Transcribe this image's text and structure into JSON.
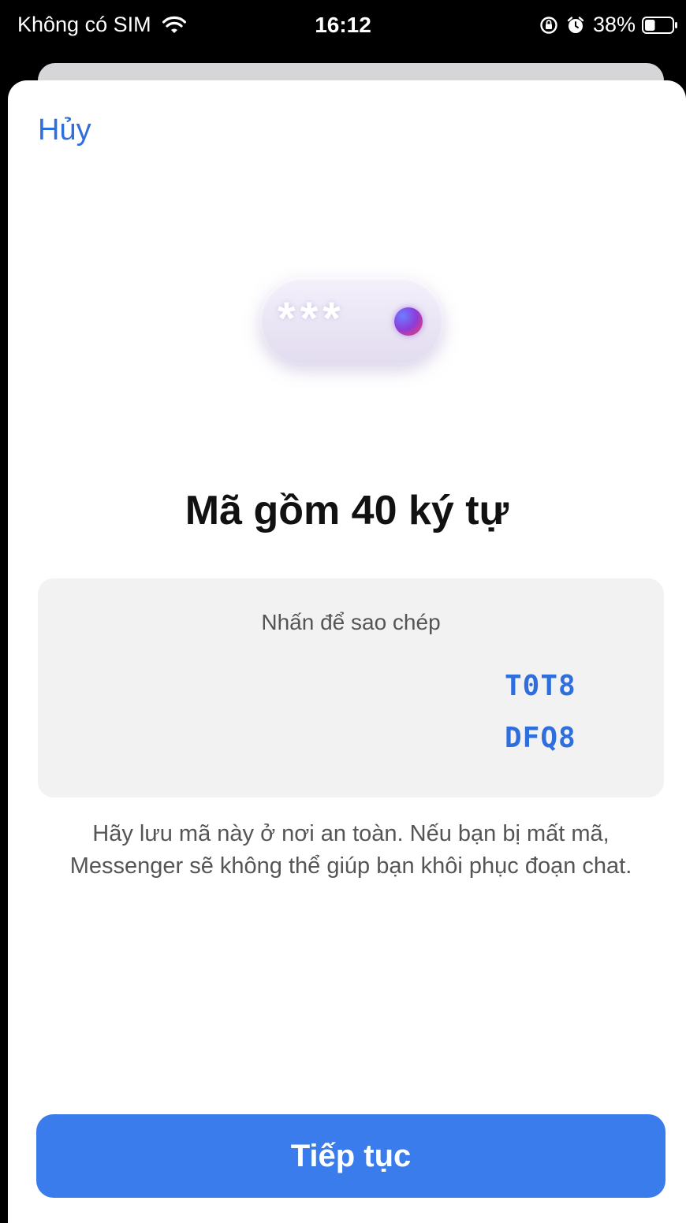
{
  "status_bar": {
    "carrier": "Không có SIM",
    "time": "16:12",
    "battery_percent": "38%",
    "battery_level": 0.38,
    "icons": [
      "wifi-icon",
      "orientation-lock-icon",
      "alarm-icon",
      "battery-icon"
    ]
  },
  "sheet": {
    "cancel_label": "Hủy",
    "hero_stars": "***",
    "title": "Mã gồm 40 ký tự",
    "code_card": {
      "hint": "Nhấn để sao chép",
      "lines": [
        "T0T8",
        "DFQ8"
      ]
    },
    "warning": "Hãy lưu mã này ở nơi an toàn. Nếu bạn bị mất mã, Messenger sẽ không thể giúp bạn khôi phục đoạn chat.",
    "continue_label": "Tiếp tục"
  },
  "colors": {
    "accent": "#3a7cec",
    "link": "#2f6fdd",
    "card_bg": "#f2f2f3"
  }
}
